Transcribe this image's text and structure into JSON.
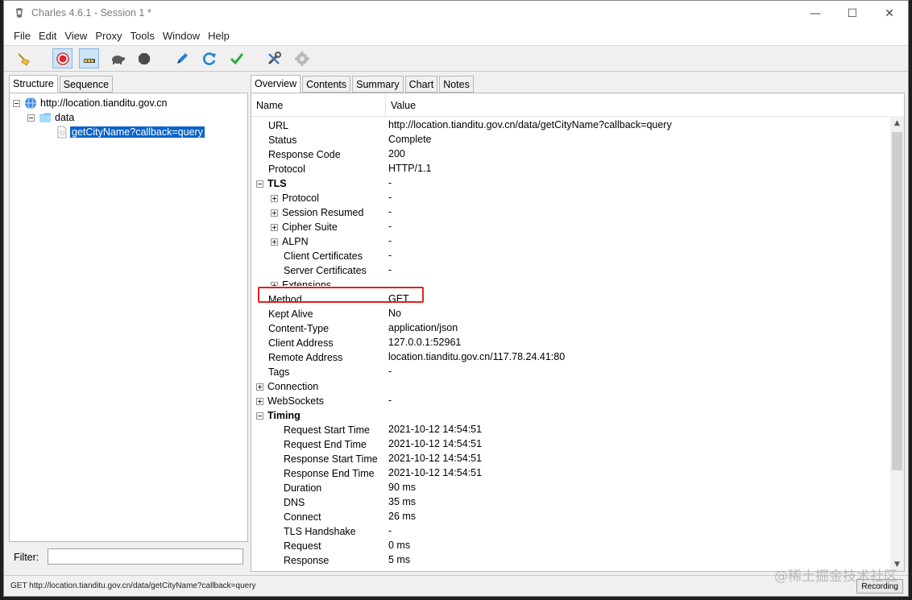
{
  "window": {
    "title": "Charles 4.6.1 - Session 1 *",
    "minimize": "—",
    "maximize": "☐",
    "close": "✕"
  },
  "menu": [
    "File",
    "Edit",
    "View",
    "Proxy",
    "Tools",
    "Window",
    "Help"
  ],
  "toolbar": {
    "icons": [
      "broom-icon",
      "record-icon",
      "throttle-icon",
      "turtle-icon",
      "stop-hexagon-icon",
      "pen-icon",
      "refresh-icon",
      "check-icon",
      "tools-icon",
      "gear-icon"
    ]
  },
  "left_tabs": [
    "Structure",
    "Sequence"
  ],
  "tree": {
    "host": "http://location.tianditu.gov.cn",
    "folder": "data",
    "file": "getCityName?callback=query"
  },
  "filter": {
    "label": "Filter:",
    "value": ""
  },
  "right_tabs": [
    "Overview",
    "Contents",
    "Summary",
    "Chart",
    "Notes"
  ],
  "table": {
    "col_name": "Name",
    "col_value": "Value",
    "rows": [
      {
        "name": "URL",
        "value": "http://location.tianditu.gov.cn/data/getCityName?callback=query"
      },
      {
        "name": "Status",
        "value": "Complete"
      },
      {
        "name": "Response Code",
        "value": "200"
      },
      {
        "name": "Protocol",
        "value": "HTTP/1.1"
      },
      {
        "name": "TLS",
        "value": "-"
      },
      {
        "name": "Protocol",
        "value": "-"
      },
      {
        "name": "Session Resumed",
        "value": "-"
      },
      {
        "name": "Cipher Suite",
        "value": "-"
      },
      {
        "name": "ALPN",
        "value": "-"
      },
      {
        "name": "Client Certificates",
        "value": "-"
      },
      {
        "name": "Server Certificates",
        "value": "-"
      },
      {
        "name": "Extensions",
        "value": ""
      },
      {
        "name": "Method",
        "value": "GET"
      },
      {
        "name": "Kept Alive",
        "value": "No"
      },
      {
        "name": "Content-Type",
        "value": "application/json"
      },
      {
        "name": "Client Address",
        "value": "127.0.0.1:52961"
      },
      {
        "name": "Remote Address",
        "value": "location.tianditu.gov.cn/117.78.24.41:80"
      },
      {
        "name": "Tags",
        "value": "-"
      },
      {
        "name": "Connection",
        "value": ""
      },
      {
        "name": "WebSockets",
        "value": "-"
      },
      {
        "name": "Timing",
        "value": ""
      },
      {
        "name": "Request Start Time",
        "value": "2021-10-12 14:54:51"
      },
      {
        "name": "Request End Time",
        "value": "2021-10-12 14:54:51"
      },
      {
        "name": "Response Start Time",
        "value": "2021-10-12 14:54:51"
      },
      {
        "name": "Response End Time",
        "value": "2021-10-12 14:54:51"
      },
      {
        "name": "Duration",
        "value": "90 ms"
      },
      {
        "name": "DNS",
        "value": "35 ms"
      },
      {
        "name": "Connect",
        "value": "26 ms"
      },
      {
        "name": "TLS Handshake",
        "value": "-"
      },
      {
        "name": "Request",
        "value": "0 ms"
      },
      {
        "name": "Response",
        "value": "5 ms"
      }
    ]
  },
  "statusbar": {
    "text": "GET http://location.tianditu.gov.cn/data/getCityName?callback=query",
    "recording": "Recording"
  },
  "watermark": "@稀土掘金技术社区"
}
